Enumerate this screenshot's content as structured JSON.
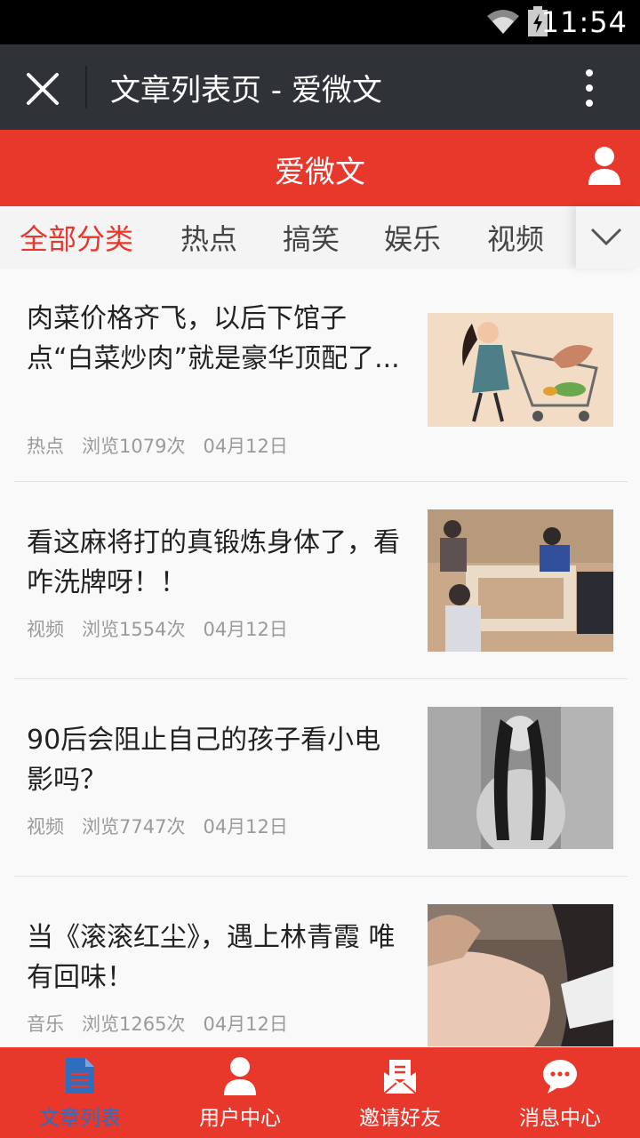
{
  "status": {
    "time": "11:54"
  },
  "window": {
    "title": "文章列表页 - 爱微文"
  },
  "app": {
    "title": "爱微文"
  },
  "tabs": [
    {
      "label": "全部分类",
      "active": true
    },
    {
      "label": "热点"
    },
    {
      "label": "搞笑"
    },
    {
      "label": "娱乐"
    },
    {
      "label": "视频"
    }
  ],
  "articles": [
    {
      "title": "肉菜价格齐飞，以后下馆子点“白菜炒肉”就是豪华顶配了...",
      "category": "热点",
      "views": "浏览1079次",
      "date": "04月12日"
    },
    {
      "title": "看这麻将打的真锻炼身体了，看咋洗牌呀！！",
      "category": "视频",
      "views": "浏览1554次",
      "date": "04月12日"
    },
    {
      "title": "90后会阻止自己的孩子看小电影吗？",
      "category": "视频",
      "views": "浏览7747次",
      "date": "04月12日"
    },
    {
      "title": "当《滚滚红尘》，遇上林青霞 唯有回味！",
      "category": "音乐",
      "views": "浏览1265次",
      "date": "04月12日"
    }
  ],
  "bottom_nav": [
    {
      "label": "文章列表",
      "icon": "document-icon",
      "active": true
    },
    {
      "label": "用户中心",
      "icon": "user-icon"
    },
    {
      "label": "邀请好友",
      "icon": "invite-mail-icon"
    },
    {
      "label": "消息中心",
      "icon": "chat-bubble-icon"
    }
  ],
  "colors": {
    "brand_red": "#e8372b",
    "titlebar": "#2f3338",
    "active_nav": "#2f6dbf"
  }
}
